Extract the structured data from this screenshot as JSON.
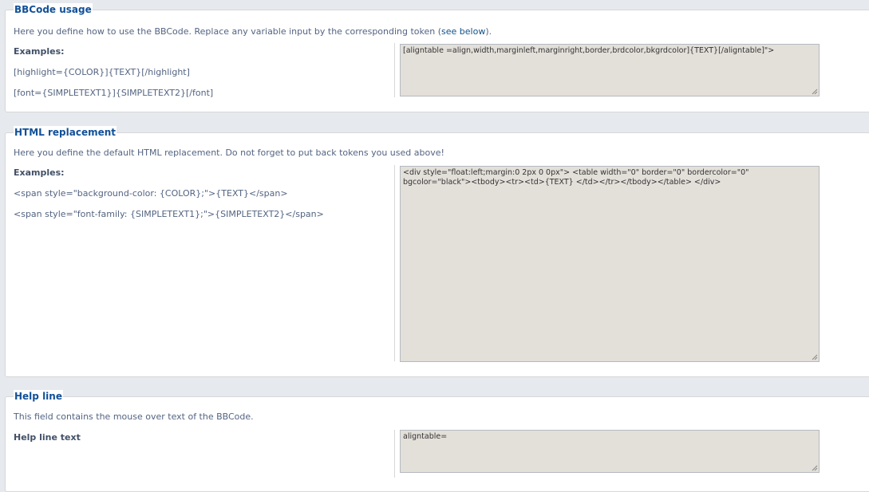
{
  "bbcode_usage": {
    "legend": "BBCode usage",
    "desc_prefix": "Here you define how to use the BBCode. Replace any variable input by the corresponding token (",
    "desc_link": "see below",
    "desc_suffix": ").",
    "examples_label": "Examples:",
    "examples": [
      "[highlight={COLOR}]{TEXT}[/highlight]",
      "[font={SIMPLETEXT1}]{SIMPLETEXT2}[/font]"
    ],
    "textarea_value": "[aligntable =align,width,marginleft,marginright,border,brdcolor,bkgrdcolor]{TEXT}[/aligntable]\">"
  },
  "html_replacement": {
    "legend": "HTML replacement",
    "desc": "Here you define the default HTML replacement. Do not forget to put back tokens you used above!",
    "examples_label": "Examples:",
    "examples": [
      "<span style=\"background-color: {COLOR};\">{TEXT}</span>",
      "<span style=\"font-family: {SIMPLETEXT1};\">{SIMPLETEXT2}</span>"
    ],
    "textarea_value": "<div style=\"float:left;margin:0 2px 0 0px\"> <table width=\"0\" border=\"0\" bordercolor=\"0\" bgcolor=\"black\"><tbody><tr><td>{TEXT} </td></tr></tbody></table> </div>"
  },
  "help_line": {
    "legend": "Help line",
    "desc": "This field contains the mouse over text of the BBCode.",
    "label": "Help line text",
    "textarea_value": "aligntable="
  }
}
